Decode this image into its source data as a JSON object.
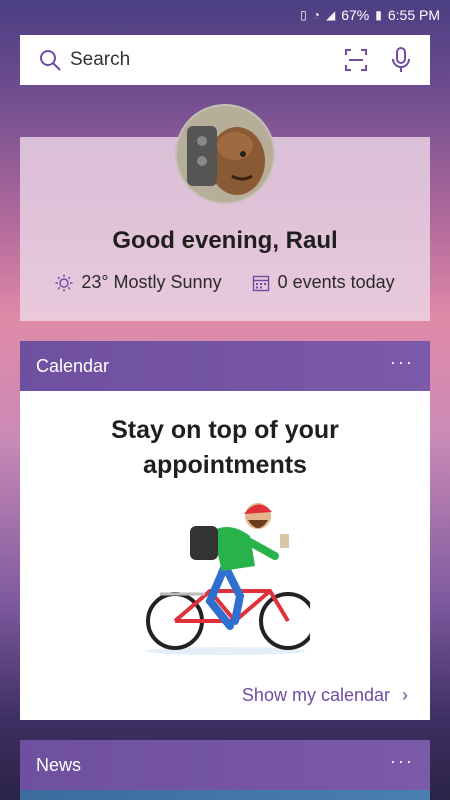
{
  "status_bar": {
    "battery": "67%",
    "time": "6:55 PM"
  },
  "search": {
    "placeholder": "Search"
  },
  "greeting": {
    "title": "Good evening, Raul",
    "weather": "23° Mostly Sunny",
    "events": "0 events today"
  },
  "calendar_card": {
    "header": "Calendar",
    "more": "···",
    "heading_line1": "Stay on top of your",
    "heading_line2": "appointments",
    "link": "Show my calendar"
  },
  "news_card": {
    "header": "News",
    "more": "···"
  },
  "colors": {
    "accent": "#6e4da0",
    "header_bg": "#7356a5"
  }
}
